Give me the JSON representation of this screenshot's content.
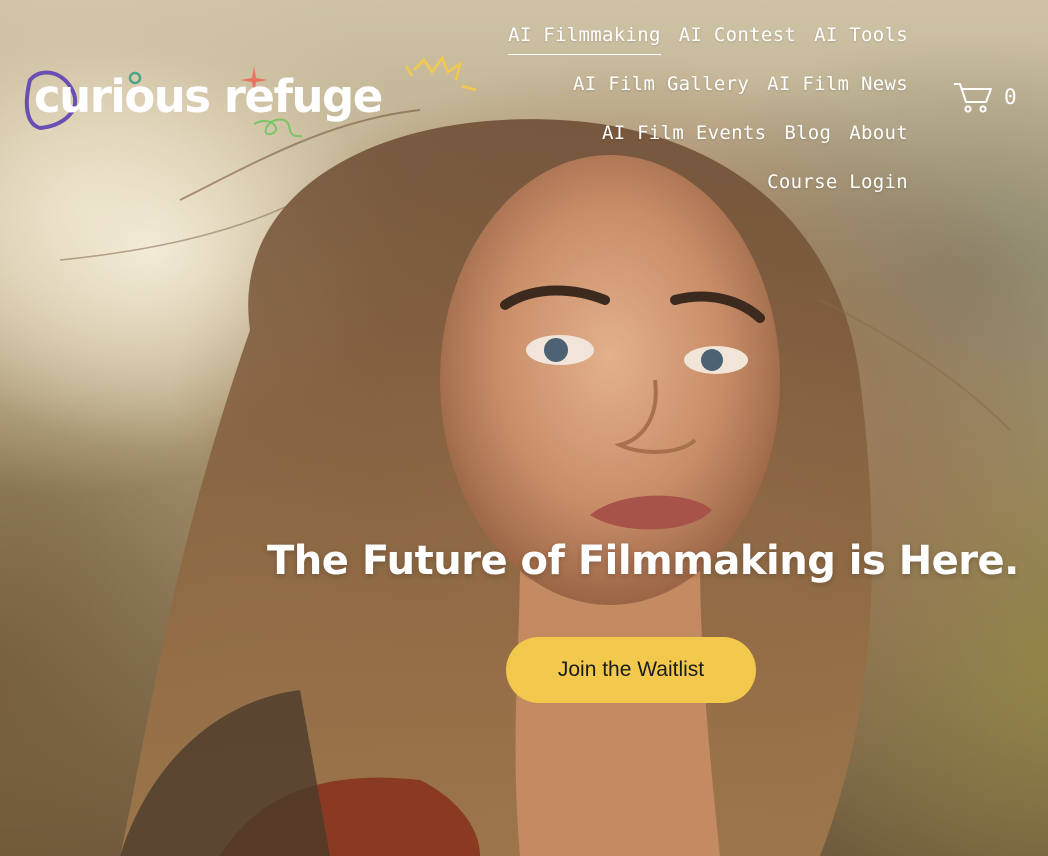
{
  "brand": {
    "logo_text": "curious refuge",
    "colors": {
      "ring": "#6a4fb3",
      "dot": "#4aa58c",
      "star": "#e8735e",
      "crown": "#f2c94c",
      "squiggle": "#7cc46a"
    }
  },
  "nav": {
    "items": [
      {
        "label": "AI Filmmaking",
        "active": true
      },
      {
        "label": "AI Contest"
      },
      {
        "label": "AI Tools"
      },
      {
        "label": "AI Film Gallery"
      },
      {
        "label": "AI Film News"
      },
      {
        "label": "AI Film Events"
      },
      {
        "label": "Blog"
      },
      {
        "label": "About"
      },
      {
        "label": "Course Login"
      }
    ]
  },
  "cart": {
    "icon": "cart-icon",
    "count": "0"
  },
  "hero": {
    "headline": "The Future of Filmmaking is Here.",
    "cta_label": "Join the Waitlist",
    "cta_color": "#f2c94c"
  }
}
